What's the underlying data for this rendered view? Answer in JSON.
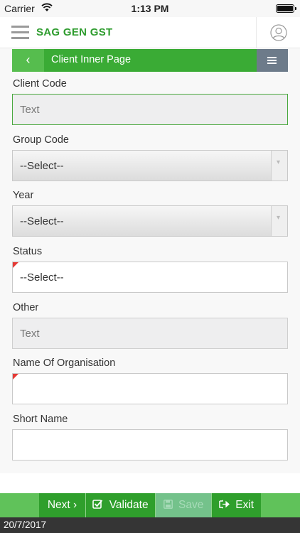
{
  "status_bar": {
    "carrier": "Carrier",
    "time": "1:13 PM"
  },
  "app": {
    "brand": "SAG GEN GST"
  },
  "page_header": {
    "title": "Client Inner Page"
  },
  "form": {
    "client_code": {
      "label": "Client Code",
      "placeholder": "Text"
    },
    "group_code": {
      "label": "Group Code",
      "value": "--Select--"
    },
    "year": {
      "label": "Year",
      "value": "--Select--"
    },
    "status": {
      "label": "Status",
      "value": "--Select--"
    },
    "other": {
      "label": "Other",
      "placeholder": "Text"
    },
    "organisation": {
      "label": "Name Of Organisation",
      "value": ""
    },
    "short_name": {
      "label": "Short Name",
      "value": ""
    }
  },
  "actions": {
    "next": "Next",
    "next_icon": "›",
    "validate": "Validate",
    "save": "Save",
    "exit": "Exit"
  },
  "footer": {
    "date": "20/7/2017"
  },
  "colors": {
    "brand_green": "#2e9c2e",
    "header_green": "#3aab35",
    "menu_slate": "#6d7b8a",
    "required_red": "#e53935"
  },
  "icons": {
    "menu": "hamburger-icon",
    "profile": "user-avatar-icon",
    "back": "chevron-left-icon",
    "validate": "checkbox-icon",
    "save": "floppy-disk-icon",
    "exit": "sign-out-icon"
  }
}
